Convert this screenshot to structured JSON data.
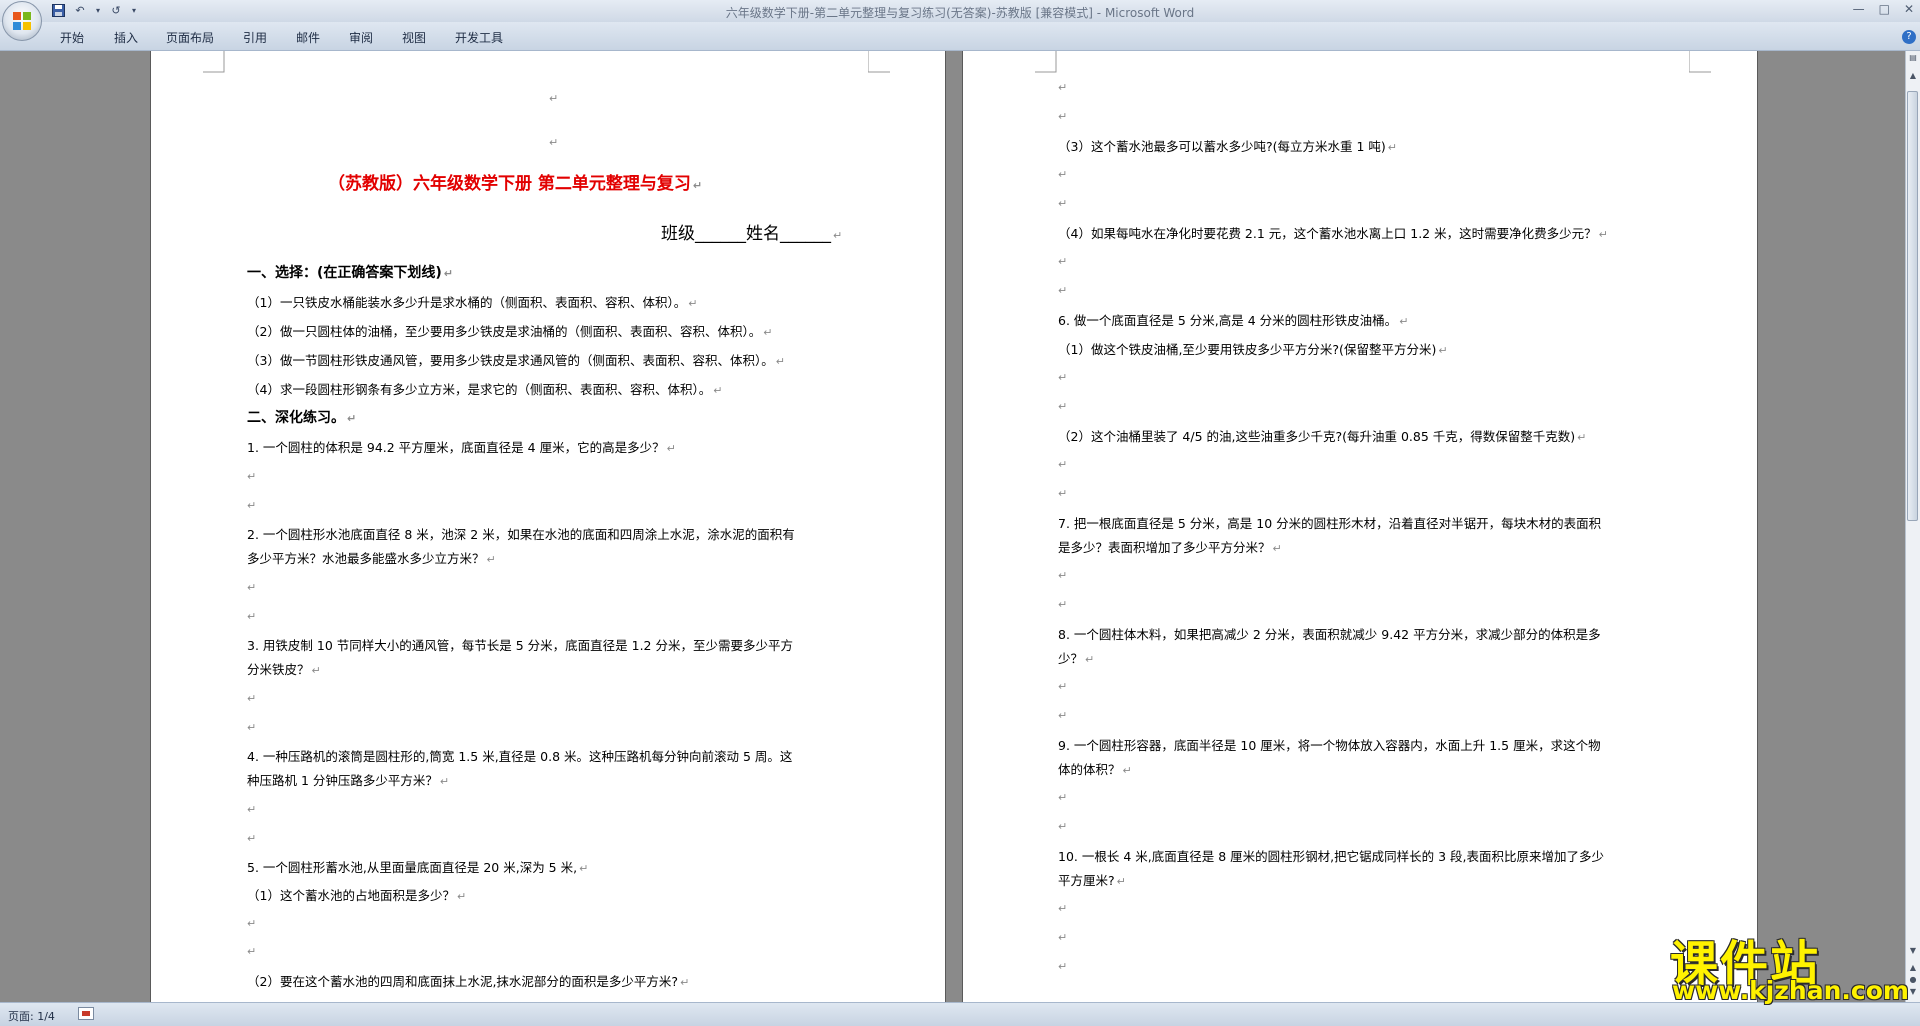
{
  "window": {
    "title": "六年级数学下册-第二单元整理与复习练习(无答案)-苏教版 [兼容模式] - Microsoft Word"
  },
  "ribbon": {
    "tabs": [
      "开始",
      "插入",
      "页面布局",
      "引用",
      "邮件",
      "审阅",
      "视图",
      "开发工具"
    ]
  },
  "page1": {
    "title": "（苏教版）六年级数学下册      第二单元整理与复习",
    "class_line": "班级______姓名______",
    "section1": "一、选择：(在正确答案下划线)",
    "choices": [
      "（1）一只铁皮水桶能装水多少升是求水桶的（侧面积、表面积、容积、体积）。",
      "（2）做一只圆柱体的油桶，至少要用多少铁皮是求油桶的（侧面积、表面积、容积、体积）。",
      "（3）做一节圆柱形铁皮通风管，要用多少铁皮是求通风管的（侧面积、表面积、容积、体积）。",
      "（4）求一段圆柱形钢条有多少立方米，是求它的（侧面积、表面积、容积、体积）。"
    ],
    "section2": "二、深化练习。",
    "q1": "1. 一个圆柱的体积是 94.2 平方厘米，底面直径是 4 厘米，它的高是多少？",
    "q2_a": "2. 一个圆柱形水池底面直径 8 米，池深 2 米，如果在水池的底面和四周涂上水泥，涂水泥的面积有",
    "q2_b": "多少平方米？水池最多能盛水多少立方米？",
    "q3_a": "3. 用铁皮制 10 节同样大小的通风管，每节长是 5 分米，底面直径是 1.2 分米，至少需要多少平方",
    "q3_b": "分米铁皮？",
    "q4_a": "4. 一种压路机的滚筒是圆柱形的,筒宽 1.5 米,直径是 0.8 米。这种压路机每分钟向前滚动 5 周。这",
    "q4_b": "种压路机 1 分钟压路多少平方米？",
    "q5": "5. 一个圆柱形蓄水池,从里面量底面直径是 20 米,深为 5 米,",
    "q5_1": "（1）这个蓄水池的占地面积是多少？",
    "q5_2": "（2）要在这个蓄水池的四周和底面抹上水泥,抹水泥部分的面积是多少平方米?"
  },
  "page2": {
    "q5_3": "（3）这个蓄水池最多可以蓄水多少吨?(每立方米水重 1 吨)",
    "q5_4": "（4）如果每吨水在净化时要花费 2.1 元，这个蓄水池水离上口 1.2 米，这时需要净化费多少元？",
    "q6": "6. 做一个底面直径是 5 分米,高是 4 分米的圆柱形铁皮油桶。",
    "q6_1": "（1）做这个铁皮油桶,至少要用铁皮多少平方分米?(保留整平方分米)",
    "q6_2": "（2）这个油桶里装了 4/5 的油,这些油重多少千克?(每升油重 0.85 千克，得数保留整千克数)",
    "q7_a": "7. 把一根底面直径是 5 分米，高是 10 分米的圆柱形木材，沿着直径对半锯开，每块木材的表面积",
    "q7_b": "是多少？表面积增加了多少平方分米？",
    "q8_a": "8. 一个圆柱体木料，如果把高减少 2 分米，表面积就减少 9.42 平方分米，求减少部分的体积是多",
    "q8_b": "少？",
    "q9_a": "9. 一个圆柱形容器，底面半径是 10 厘米，将一个物体放入容器内，水面上升 1.5 厘米，求这个物",
    "q9_b": "体的体积？",
    "q10_a": "10. 一根长 4 米,底面直径是 8 厘米的圆柱形钢材,把它锯成同样长的 3 段,表面积比原来增加了多少",
    "q10_b": "平方厘米?"
  },
  "status": {
    "page": "页面: 1/4"
  },
  "watermark": {
    "logo": "课件站",
    "url": "www.kjzhan.com"
  }
}
